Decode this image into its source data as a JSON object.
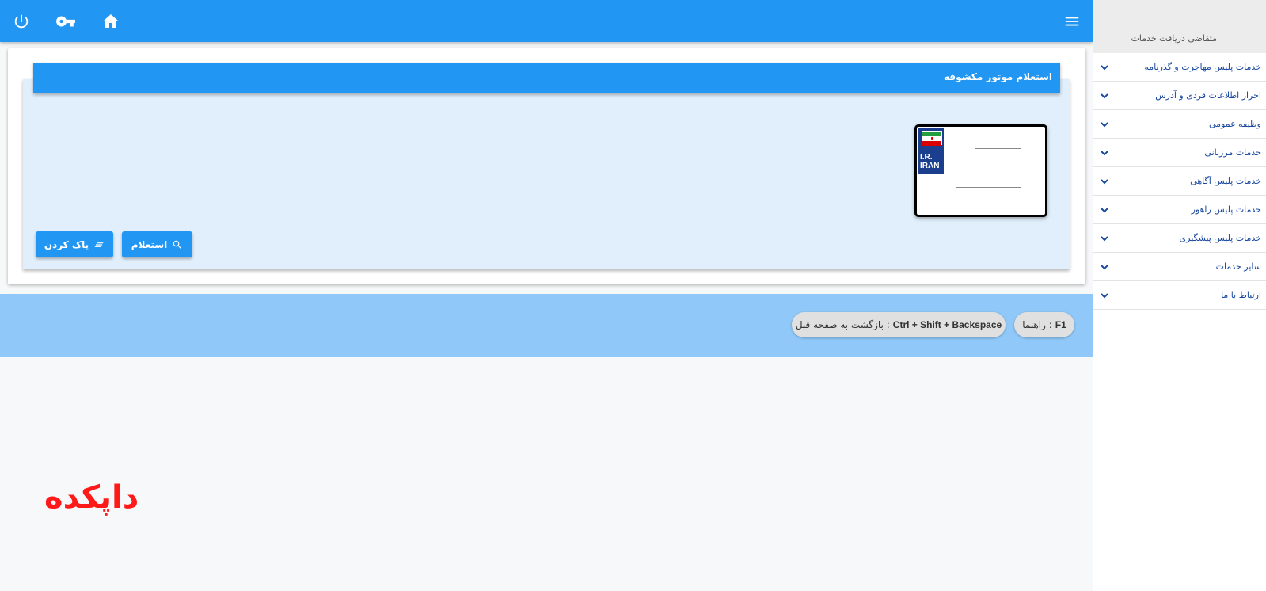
{
  "header": {
    "icons": [
      "power-icon",
      "key-icon",
      "home-icon",
      "menu-icon"
    ]
  },
  "panel": {
    "title": "استعلام موتور مکشوفه"
  },
  "plate": {
    "country_line1": "I.R.",
    "country_line2": "IRAN"
  },
  "actions": {
    "inquiry_label": "استعلام",
    "clear_label": "پاک کردن"
  },
  "hints": {
    "help_key": "F1",
    "help_text": ": راهنما",
    "back_key": "Ctrl + Shift + Backspace",
    "back_text": ": بازگشت به صفحه قبل"
  },
  "watermark": "داپکده",
  "sidebar": {
    "header": "متقاضی دریافت خدمات",
    "items": [
      {
        "label": "خدمات پلیس مهاجرت و گذرنامه"
      },
      {
        "label": "احراز اطلاعات فردی و آدرس"
      },
      {
        "label": "وظیفه عمومی"
      },
      {
        "label": "خدمات مرزبانی"
      },
      {
        "label": "خدمات پلیس آگاهی"
      },
      {
        "label": "خدمات پلیس راهور"
      },
      {
        "label": "خدمات پلیس پیشگیری"
      },
      {
        "label": "سایر خدمات"
      },
      {
        "label": "ارتباط با ما"
      }
    ]
  },
  "colors": {
    "primary": "#2196f3",
    "panel_bg": "#e1effc",
    "hint_bar": "#90c9f9",
    "sidebar_text": "#17479e",
    "watermark": "#ff1a1a"
  }
}
